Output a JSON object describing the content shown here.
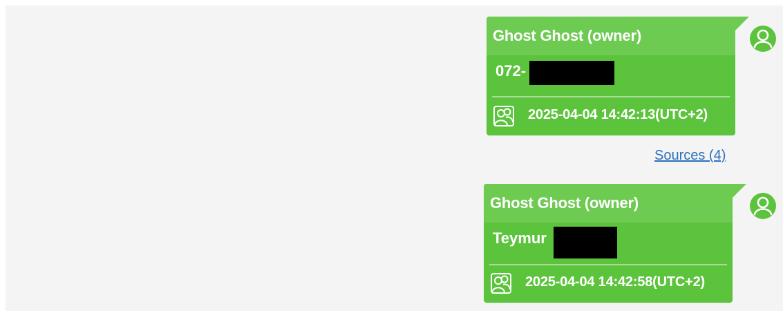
{
  "messages": [
    {
      "sender": "Ghost Ghost (owner)",
      "text": "072-",
      "timestamp": "2025-04-04 14:42:13(UTC+2)",
      "avatar_icon": "user-avatar-icon",
      "group_icon": "group-chat-icon"
    },
    {
      "sender": "Ghost Ghost (owner)",
      "text": "Teymur",
      "timestamp": "2025-04-04 14:42:58(UTC+2)",
      "avatar_icon": "user-avatar-icon",
      "group_icon": "group-chat-icon"
    }
  ],
  "sources_link": "Sources (4)",
  "colors": {
    "bubble": "#5cc33c",
    "bubble_header": "#6ecb52",
    "panel": "#f4f4f4",
    "link": "#2a6fbf"
  }
}
